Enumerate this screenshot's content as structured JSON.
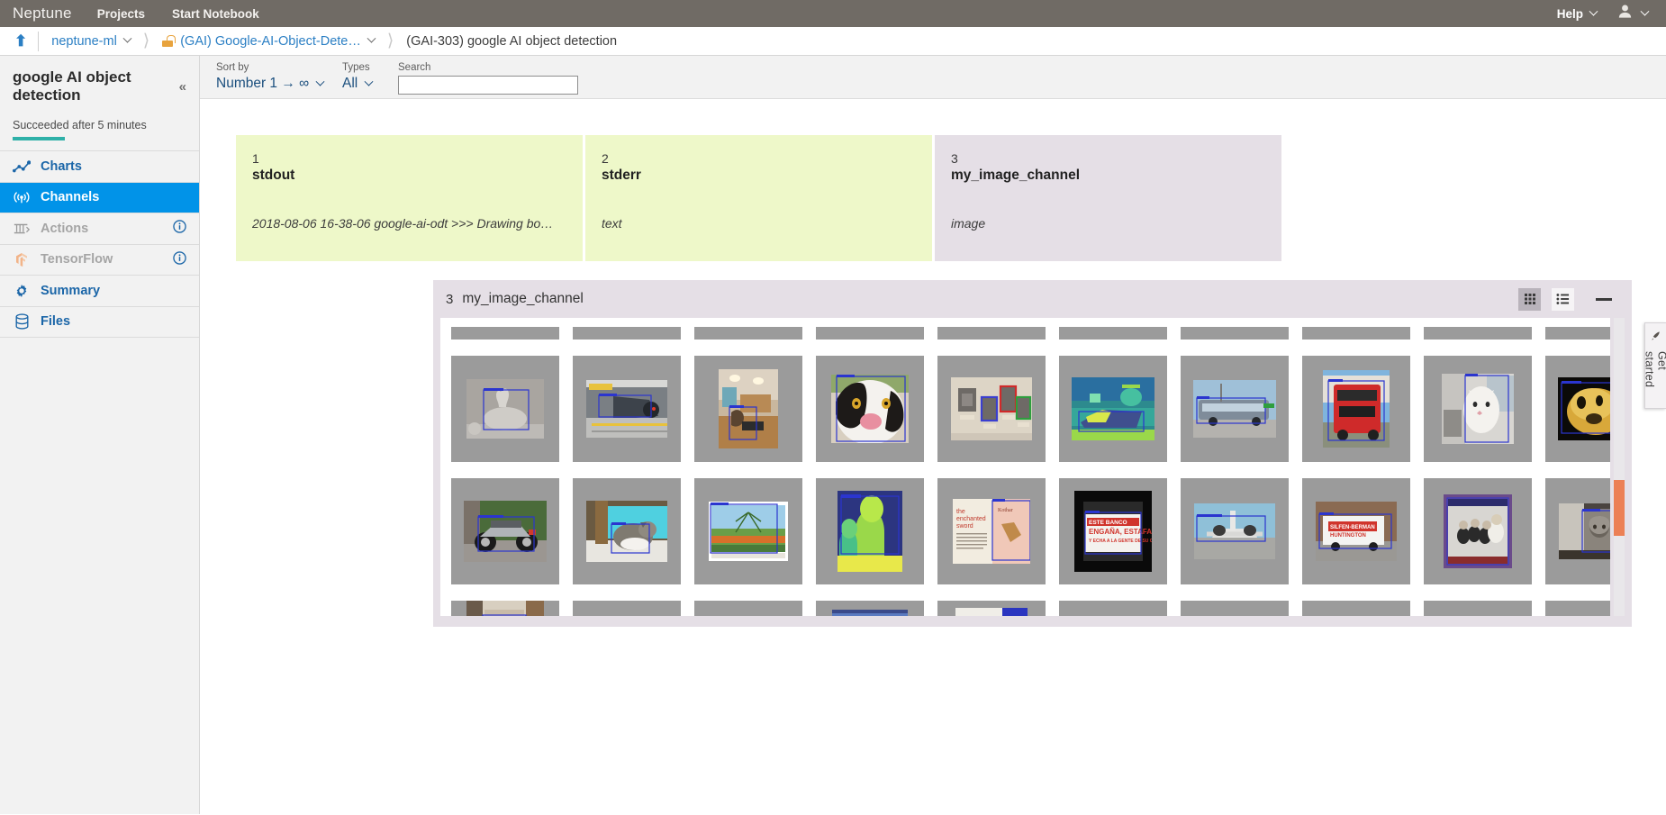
{
  "topnav": {
    "brand": "Neptune",
    "links": [
      {
        "label": "Projects",
        "name": "nav-projects"
      },
      {
        "label": "Start Notebook",
        "name": "nav-start-notebook"
      }
    ],
    "help_label": "Help",
    "user_icon": "user-avatar-icon"
  },
  "breadcrumb": {
    "up_icon": "up-arrow-icon",
    "items": [
      {
        "label": "neptune-ml",
        "has_chevron": true,
        "lock": false
      },
      {
        "label": "(GAI) Google-AI-Object-Dete…",
        "has_chevron": true,
        "lock": true
      },
      {
        "label": "(GAI-303) google AI object detection",
        "has_chevron": false,
        "lock": false
      }
    ]
  },
  "sidebar": {
    "experiment_title": "google AI object detection",
    "collapse_icon": "collapse-chevrons-icon",
    "status": "Succeeded after 5 minutes",
    "items": [
      {
        "label": "Charts",
        "icon": "line-chart-icon",
        "state": "default",
        "info": false
      },
      {
        "label": "Channels",
        "icon": "broadcast-icon",
        "state": "active",
        "info": false
      },
      {
        "label": "Actions",
        "icon": "actions-icon",
        "state": "disabled",
        "info": true
      },
      {
        "label": "TensorFlow",
        "icon": "tensorflow-icon",
        "state": "disabled",
        "info": true
      },
      {
        "label": "Summary",
        "icon": "gear-icon",
        "state": "default",
        "info": false
      },
      {
        "label": "Files",
        "icon": "database-icon",
        "state": "default",
        "info": false
      }
    ]
  },
  "filterbar": {
    "sort_label": "Sort by",
    "sort_value": "Number 1 → ∞",
    "types_label": "Types",
    "types_value": "All",
    "search_label": "Search",
    "search_value": "",
    "search_placeholder": ""
  },
  "channel_cards": [
    {
      "number": "1",
      "name": "stdout",
      "type": "2018-08-06 16-38-06 google-ai-odt >>> Drawing bo…",
      "kind": "text"
    },
    {
      "number": "2",
      "name": "stderr",
      "type": "text",
      "kind": "text"
    },
    {
      "number": "3",
      "name": "my_image_channel",
      "type": "image",
      "kind": "image"
    }
  ],
  "gallery": {
    "number": "3",
    "title": "my_image_channel",
    "grid_icon": "grid-view-icon",
    "list_icon": "list-view-icon",
    "minimize_icon": "minimize-icon",
    "view_mode": "grid",
    "thumbnails": [
      {
        "alt": "statue-crown-detection"
      },
      {
        "alt": "train-station-detection"
      },
      {
        "alt": "cat-living-room-detection"
      },
      {
        "alt": "cat-face-closeup-detection"
      },
      {
        "alt": "wall-frames-detection"
      },
      {
        "alt": "heatmap-interior-detection"
      },
      {
        "alt": "coach-bus-detection"
      },
      {
        "alt": "red-double-decker-bus-detection"
      },
      {
        "alt": "white-kitten-detection"
      },
      {
        "alt": "golden-dog-detection"
      },
      {
        "alt": "motorcycle-detection"
      },
      {
        "alt": "cat-window-sill-detection"
      },
      {
        "alt": "park-fountain-postcard-detection"
      },
      {
        "alt": "heatmap-statue-detection"
      },
      {
        "alt": "book-enchanted-sword-detection"
      },
      {
        "alt": "protest-sign-este-banco-detection"
      },
      {
        "alt": "airplane-tarmac-detection"
      },
      {
        "alt": "silfen-berman-truck-detection"
      },
      {
        "alt": "vintage-audience-photo-detection"
      },
      {
        "alt": "lion-sculpture-detection"
      }
    ],
    "scrollbar_color": "#ec8055"
  },
  "get_started": {
    "label": "Get started",
    "icon": "rocket-icon"
  },
  "colors": {
    "topnav_bg": "#706b65",
    "link_blue": "#2b7fc4",
    "active_blue": "#0193e8",
    "status_teal": "#2eb0a8",
    "card_text_bg": "#eef8c9",
    "card_image_bg": "#e5dfe6",
    "scroll_orange": "#ec8055"
  }
}
